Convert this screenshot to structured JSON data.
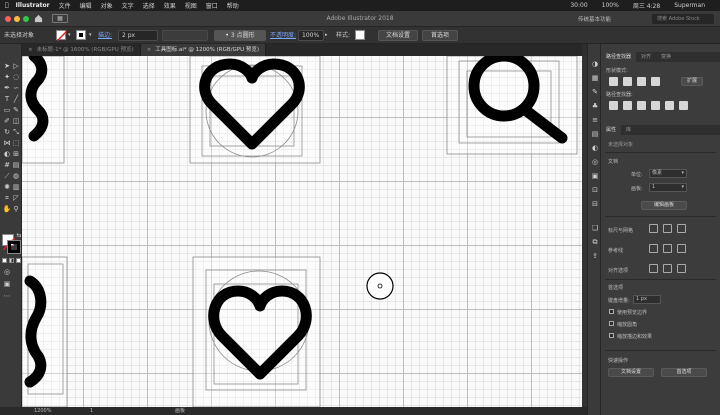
{
  "menubar": {
    "app": "Illustrator",
    "items": [
      "文件",
      "编辑",
      "对象",
      "文字",
      "选择",
      "效果",
      "视图",
      "窗口",
      "帮助"
    ],
    "status_time": "周三 4:28",
    "user": "Superman",
    "battery": "100%",
    "clock": "30:00"
  },
  "titlebar": {
    "title": "Adobe Illustrator 2018",
    "workspace": "传统基本功能",
    "search_placeholder": "搜索 Adobe Stock",
    "traffic_colors": [
      "#fc605c",
      "#fdbc40",
      "#34c84a"
    ]
  },
  "controlbar": {
    "selection": "未选择对象",
    "stroke_label": "描边:",
    "stroke_value": "2 px",
    "brush": "3 点圆形",
    "opacity_label": "不透明度:",
    "opacity_value": "100%",
    "style_label": "样式:",
    "doc_setup": "文档设置",
    "preferences": "首选项"
  },
  "tabs": [
    {
      "label": "未标题-1* @ 1600% (RGB/GPU 预览)",
      "active": false
    },
    {
      "label": "工具图标.ai* @ 1200% (RGB/GPU 预览)",
      "active": true
    }
  ],
  "statusbar": {
    "zoom": "1200%",
    "page": "1",
    "mode": "画板"
  },
  "panel": {
    "top_tabs": [
      "路径查找器",
      "对齐",
      "变换"
    ],
    "shape_modes": "形状模式:",
    "expand": "扩展",
    "pathfinder": "路径查找器:",
    "props_tabs": [
      "属性",
      "库"
    ],
    "no_selection": "未选择对象",
    "document": "文档",
    "units_label": "单位:",
    "units_value": "像素",
    "artboard_label": "画板:",
    "artboard_value": "1",
    "edit_artboard": "编辑画板",
    "rulers_grids": "标尺与网格",
    "guides": "参考线",
    "align_options": "对齐选项",
    "preferences_head": "首选项",
    "keyboard_increment_label": "键盘增量:",
    "keyboard_increment_value": "1 px",
    "use_preview_bounds": "使用预览边界",
    "scale_corners": "缩放圆角",
    "scale_strokes": "缩放描边和效果",
    "quick_actions": "快速操作",
    "doc_setup_btn": "文档设置",
    "prefs_btn": "首选项"
  }
}
